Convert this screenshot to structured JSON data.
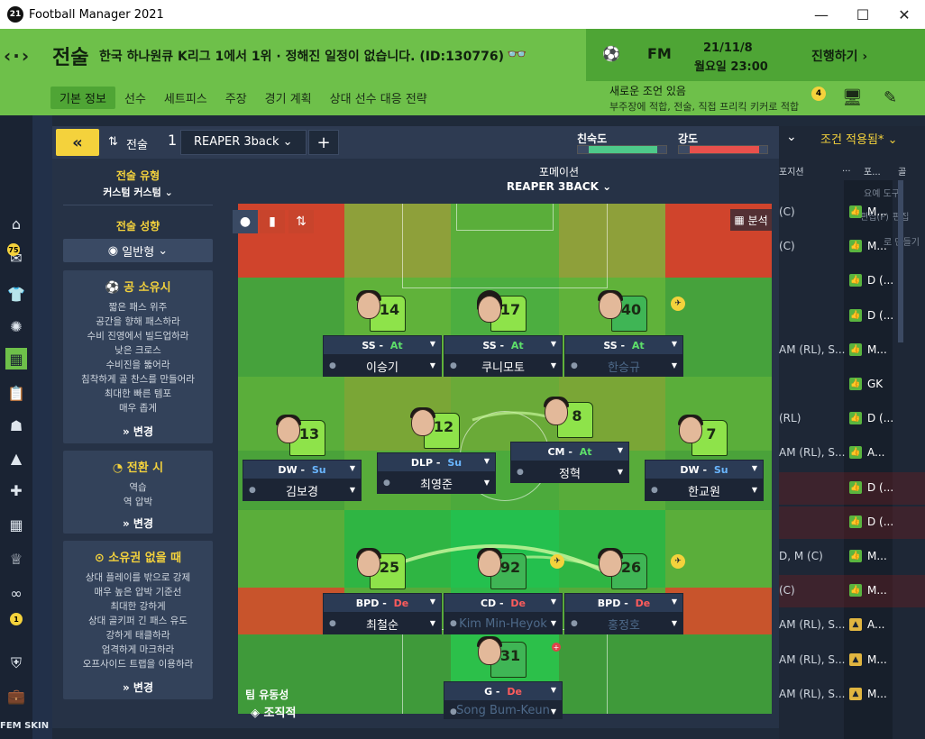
{
  "window": {
    "title": "Football Manager 2021",
    "badge": "21",
    "minimize": "—",
    "maximize": "☐",
    "close": "✕"
  },
  "header": {
    "nav": "‹·›",
    "title": "전술",
    "subtitle": "한국 하나원큐 K리그 1에서 1위 · 정해진 일정이 없습니다. (ID:130776)",
    "fm_label": "FM",
    "date": "21/11/8",
    "day_time": "월요일 23:00",
    "continue": "진행하기",
    "tabs": [
      "기본 정보",
      "선수",
      "세트피스",
      "주장",
      "경기 계획",
      "상대 선수 대응 전략"
    ],
    "advice_title": "새로운 조언 있음",
    "advice_text": "부주장에 적합, 전술, 직접 프리킥 키커로 적합",
    "advice_count": "4"
  },
  "sidebar": {
    "badge_top": "75",
    "badge_bottom": "1",
    "skin_label": "FEM SKIN"
  },
  "toolbar": {
    "back": "«",
    "tactics_label": "전술",
    "slot_number": "1",
    "tactic_name": "REAPER 3back",
    "add": "+",
    "familiarity": "친숙도",
    "intensity": "강도"
  },
  "meters": {
    "familiarity_fill": 0.88,
    "intensity_fill": 0.9,
    "familiarity_color": "#4ec98a",
    "intensity_color": "#e8504c"
  },
  "left_panel": {
    "style_title": "전술 유형",
    "style_value": "커스텀 커스텀",
    "mentality_title": "전술 성향",
    "mentality_value": "일반형",
    "in_possession": {
      "title": "공 소유시",
      "items": [
        "짧은 패스 위주",
        "공간을 향해 패스하라",
        "수비 진영에서 빌드업하라",
        "낮은 크로스",
        "수비진을 뚫어라",
        "침착하게 골 찬스를 만들어라",
        "최대한 빠른 템포",
        "매우 좁게"
      ],
      "button": "변경"
    },
    "transition": {
      "title": "전환 시",
      "items": [
        "역습",
        "역 압박"
      ],
      "button": "변경"
    },
    "out_of_possession": {
      "title": "소유권 없을 때",
      "items": [
        "상대 플레이를 밖으로 강제",
        "매우 높은 압박 기준선",
        "최대한 강하게",
        "상대 골키퍼 긴 패스 유도",
        "강하게 태클하라",
        "엄격하게 마크하라",
        "오프사이드 트랩을 이용하라"
      ],
      "button": "변경"
    }
  },
  "formation": {
    "title": "포메이션",
    "name": "REAPER 3BACK"
  },
  "pitch": {
    "analysis": "분석",
    "fluidity_title": "팀 유동성",
    "fluidity_value": "조직적",
    "players": [
      {
        "num": "14",
        "role": "SS",
        "duty": "At",
        "name": "이승기",
        "dim": false
      },
      {
        "num": "17",
        "role": "SS",
        "duty": "At",
        "name": "쿠니모토",
        "dim": false
      },
      {
        "num": "40",
        "role": "SS",
        "duty": "At",
        "name": "한승규",
        "dim": true
      },
      {
        "num": "13",
        "role": "DW",
        "duty": "Su",
        "name": "김보경",
        "dim": false
      },
      {
        "num": "12",
        "role": "DLP",
        "duty": "Su",
        "name": "최영준",
        "dim": false
      },
      {
        "num": "8",
        "role": "CM",
        "duty": "At",
        "name": "정혁",
        "dim": false
      },
      {
        "num": "7",
        "role": "DW",
        "duty": "Su",
        "name": "한교원",
        "dim": false
      },
      {
        "num": "25",
        "role": "BPD",
        "duty": "De",
        "name": "최철순",
        "dim": false
      },
      {
        "num": "92",
        "role": "CD",
        "duty": "De",
        "name": "Kim Min-Heyok",
        "dim": true
      },
      {
        "num": "26",
        "role": "BPD",
        "duty": "De",
        "name": "홍정호",
        "dim": true
      },
      {
        "num": "31",
        "role": "G",
        "duty": "De",
        "name": "Song Bum-Keun",
        "dim": true
      }
    ]
  },
  "right_list": {
    "header_caret": "⌄",
    "filter": "조건 적용됨*",
    "col_position": "포지션",
    "col_2": "...",
    "col_3": "포...",
    "col_4": "골",
    "overlay_line1": "요예 도구",
    "overlay_line2": "편집(F)",
    "overlay_line3": "편집",
    "overlay_line4": "로 만들기",
    "rows": [
      {
        "pos": "(C)",
        "val": "M...",
        "warn": false
      },
      {
        "pos": "(C)",
        "val": "M...",
        "warn": false
      },
      {
        "pos": "",
        "val": "D (...",
        "warn": false
      },
      {
        "pos": "",
        "val": "D (...",
        "warn": false
      },
      {
        "pos": "AM (RL), S...",
        "val": "M...",
        "warn": false
      },
      {
        "pos": "",
        "val": "GK",
        "warn": false
      },
      {
        "pos": "(RL)",
        "val": "D (...",
        "warn": false
      },
      {
        "pos": "AM (RL), S...",
        "val": "A...",
        "warn": false
      },
      {
        "pos": "",
        "val": "D (...",
        "warn": false
      },
      {
        "pos": "",
        "val": "D (...",
        "warn": false
      },
      {
        "pos": "D, M (C)",
        "val": "M...",
        "warn": false
      },
      {
        "pos": "(C)",
        "val": "M...",
        "warn": false
      },
      {
        "pos": "AM (RL), S...",
        "val": "A...",
        "warn": true
      },
      {
        "pos": "AM (RL), S...",
        "val": "M...",
        "warn": true
      },
      {
        "pos": "AM (RL), S...",
        "val": "M...",
        "warn": true
      }
    ]
  }
}
